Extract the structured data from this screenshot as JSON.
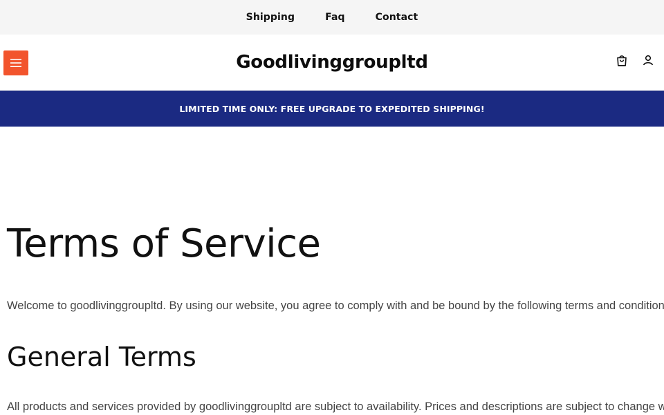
{
  "topbar": {
    "links": [
      {
        "label": "Shipping"
      },
      {
        "label": "Faq"
      },
      {
        "label": "Contact"
      }
    ]
  },
  "header": {
    "brand": "Goodlivinggroupltd",
    "menu_icon": "hamburger-icon",
    "cart_icon": "shopping-bag-icon",
    "account_icon": "user-icon",
    "accent_color": "#f2542d"
  },
  "announcement": {
    "text": "LIMITED TIME ONLY: FREE UPGRADE TO EXPEDITED SHIPPING!",
    "background": "#1b2a82"
  },
  "main": {
    "title": "Terms of Service",
    "intro": "Welcome to goodlivinggroupltd. By using our website, you agree to comply with and be bound by the following terms and conditions.",
    "sections": [
      {
        "heading": "General Terms",
        "text": "All products and services provided by goodlivinggroupltd are subject to availability. Prices and descriptions are subject to change without"
      }
    ]
  }
}
